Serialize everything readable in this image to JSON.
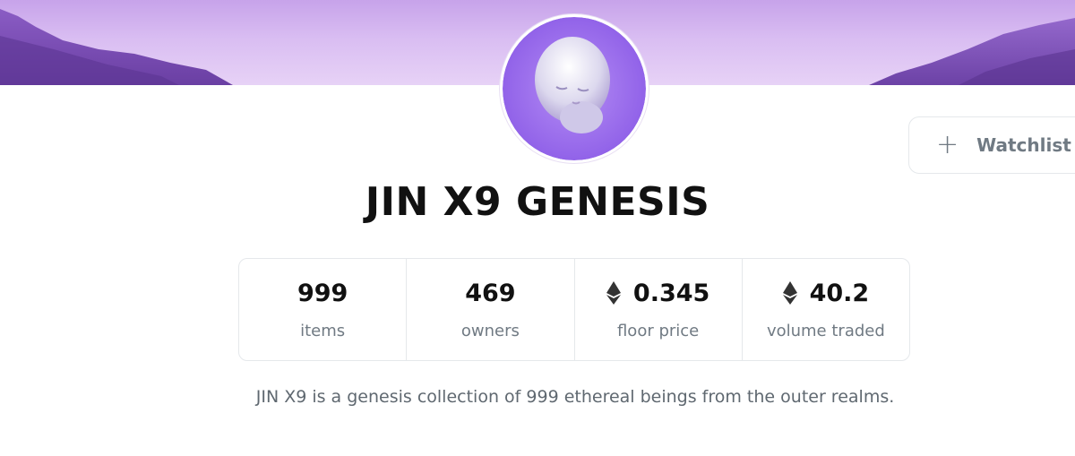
{
  "collection": {
    "name": "JIN X9 GENESIS",
    "description": "JIN X9 is a genesis collection of 999 ethereal beings from the outer realms."
  },
  "watchlist": {
    "icon": "plus-icon",
    "label": "Watchlist"
  },
  "stats": [
    {
      "value": "999",
      "label": "items",
      "icon": ""
    },
    {
      "value": "469",
      "label": "owners",
      "icon": ""
    },
    {
      "value": "0.345",
      "label": "floor price",
      "icon": "ethereum-icon"
    },
    {
      "value": "40.2",
      "label": "volume traded",
      "icon": "ethereum-icon"
    }
  ],
  "colors": {
    "banner": "#d3b6f0",
    "avatar_bg": "#9b6cf0",
    "text_primary": "#111111",
    "text_secondary": "#707a83",
    "border": "#e5e8eb"
  }
}
